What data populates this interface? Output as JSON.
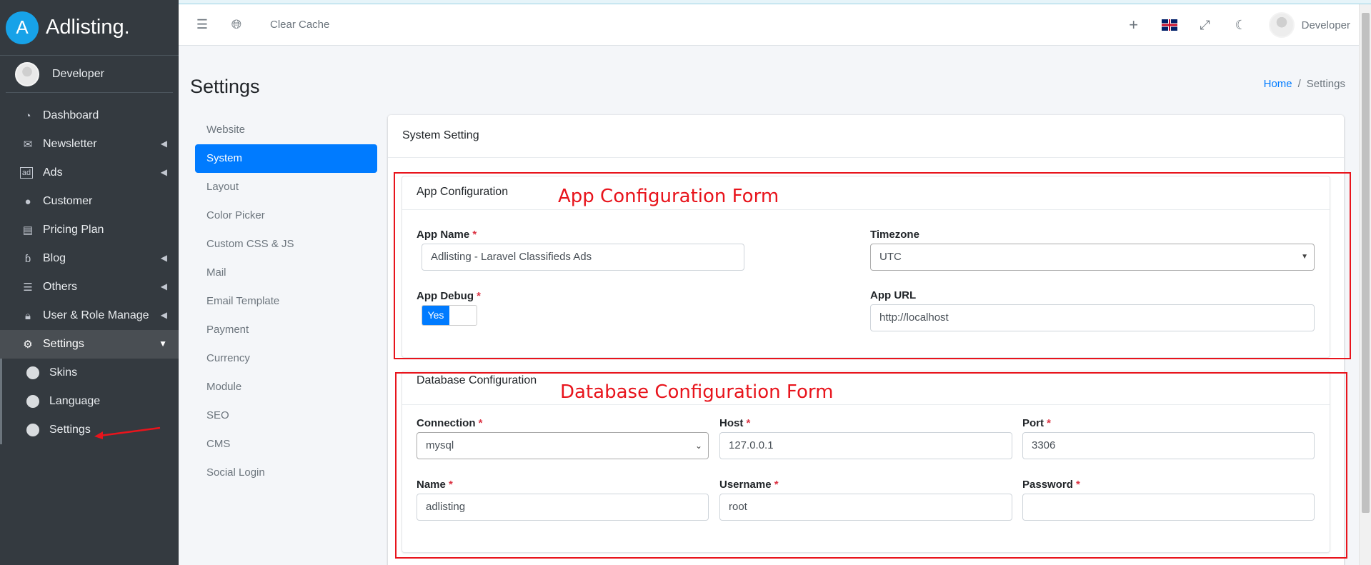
{
  "brand": {
    "logo_letter": "A",
    "name": "Adlisting."
  },
  "sidebar": {
    "user": "Developer",
    "items": [
      {
        "label": "Dashboard",
        "icon": "dashboard-icon",
        "submenu": false
      },
      {
        "label": "Newsletter",
        "icon": "envelope-icon",
        "submenu": true
      },
      {
        "label": "Ads",
        "icon": "ad-icon",
        "submenu": true
      },
      {
        "label": "Customer",
        "icon": "user-icon",
        "submenu": false
      },
      {
        "label": "Pricing Plan",
        "icon": "credit-card-icon",
        "submenu": false
      },
      {
        "label": "Blog",
        "icon": "blog-icon",
        "submenu": true
      },
      {
        "label": "Others",
        "icon": "list-icon",
        "submenu": true
      },
      {
        "label": "User & Role Manage",
        "icon": "lock-icon",
        "submenu": true
      },
      {
        "label": "Settings",
        "icon": "gear-icon",
        "submenu": true,
        "active": true
      }
    ],
    "sub_items": [
      {
        "label": "Skins"
      },
      {
        "label": "Language"
      },
      {
        "label": "Settings"
      }
    ]
  },
  "topbar": {
    "clear_cache": "Clear Cache",
    "user": "Developer"
  },
  "page": {
    "title": "Settings",
    "breadcrumb": {
      "home": "Home",
      "separator": "/",
      "current": "Settings"
    }
  },
  "settings_menu": [
    "Website",
    "System",
    "Layout",
    "Color Picker",
    "Custom CSS & JS",
    "Mail",
    "Email Template",
    "Payment",
    "Currency",
    "Module",
    "SEO",
    "CMS",
    "Social Login"
  ],
  "settings_menu_active": "System",
  "card": {
    "title": "System Setting"
  },
  "app_config": {
    "title": "App Configuration",
    "app_name_label": "App Name",
    "app_name_value": "Adlisting - Laravel Classifieds Ads",
    "timezone_label": "Timezone",
    "timezone_value": "UTC",
    "app_debug_label": "App Debug",
    "app_debug_value": "Yes",
    "app_url_label": "App URL",
    "app_url_value": "http://localhost"
  },
  "db_config": {
    "title": "Database Configuration",
    "connection_label": "Connection",
    "connection_value": "mysql",
    "host_label": "Host",
    "host_value": "127.0.0.1",
    "port_label": "Port",
    "port_value": "3306",
    "name_label": "Name",
    "name_value": "adlisting",
    "username_label": "Username",
    "username_value": "root",
    "password_label": "Password",
    "password_value": ""
  },
  "required_mark": "*",
  "annotations": {
    "app_form": "App Configuration Form",
    "db_form": "Database Configuration Form"
  },
  "colors": {
    "sidebar": "#343a40",
    "primary": "#007bff",
    "annotation": "#e8141c",
    "required": "#dc3545"
  }
}
